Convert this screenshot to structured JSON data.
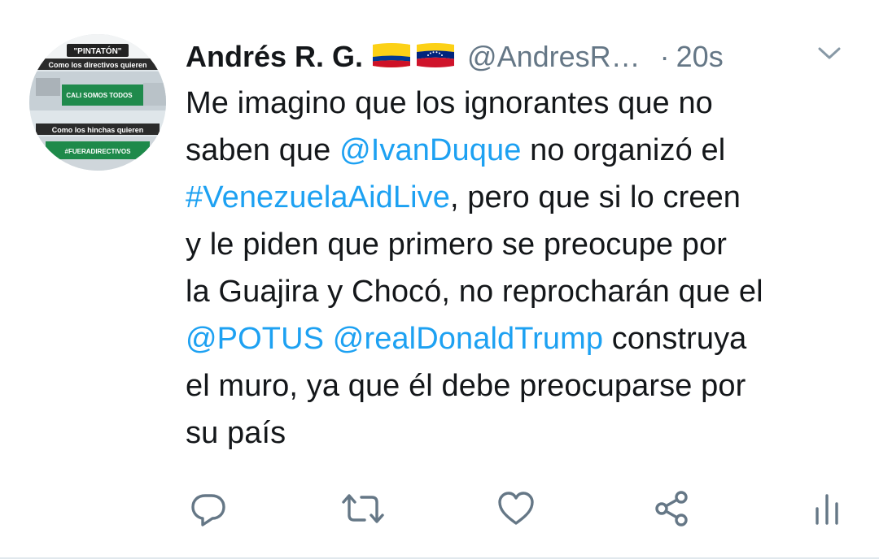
{
  "user": {
    "display_name": "Andrés R. G.",
    "handle": "@AndresR…",
    "time": "20s",
    "separator": "·",
    "flags": [
      "colombia-flag",
      "venezuela-flag"
    ]
  },
  "avatar": {
    "top_label": "\"PINTATÓN\"",
    "caption_top": "Como los directivos quieren",
    "caption_bottom": "Como los hinchas quieren",
    "wall_text": "CALI SOMOS TODOS",
    "hashtag": "#FUERADIRECTIVOS"
  },
  "tweet": {
    "lines": [
      [
        {
          "text": "Me imagino que los ignorantes que no",
          "link": false
        }
      ],
      [
        {
          "text": "saben que ",
          "link": false
        },
        {
          "text": "@IvanDuque",
          "link": true
        },
        {
          "text": " no organizó el",
          "link": false
        }
      ],
      [
        {
          "text": "#VenezuelaAidLive",
          "link": true
        },
        {
          "text": ", pero que si lo creen",
          "link": false
        }
      ],
      [
        {
          "text": "y le piden que primero se preocupe por",
          "link": false
        }
      ],
      [
        {
          "text": "la Guajira y Chocó, no reprocharán que el",
          "link": false
        }
      ],
      [
        {
          "text": "@POTUS",
          "link": true
        },
        {
          "text": " ",
          "link": false
        },
        {
          "text": "@realDonaldTrump",
          "link": true
        },
        {
          "text": " construya",
          "link": false
        }
      ],
      [
        {
          "text": "el muro, ya que él debe preocuparse por",
          "link": false
        }
      ],
      [
        {
          "text": "su país",
          "link": false
        }
      ]
    ]
  },
  "actions": [
    "reply-icon",
    "retweet-icon",
    "like-icon",
    "share-icon",
    "analytics-icon"
  ],
  "colors": {
    "text": "#14171a",
    "secondary": "#657786",
    "link": "#1da1f2",
    "icon": "#657786"
  }
}
